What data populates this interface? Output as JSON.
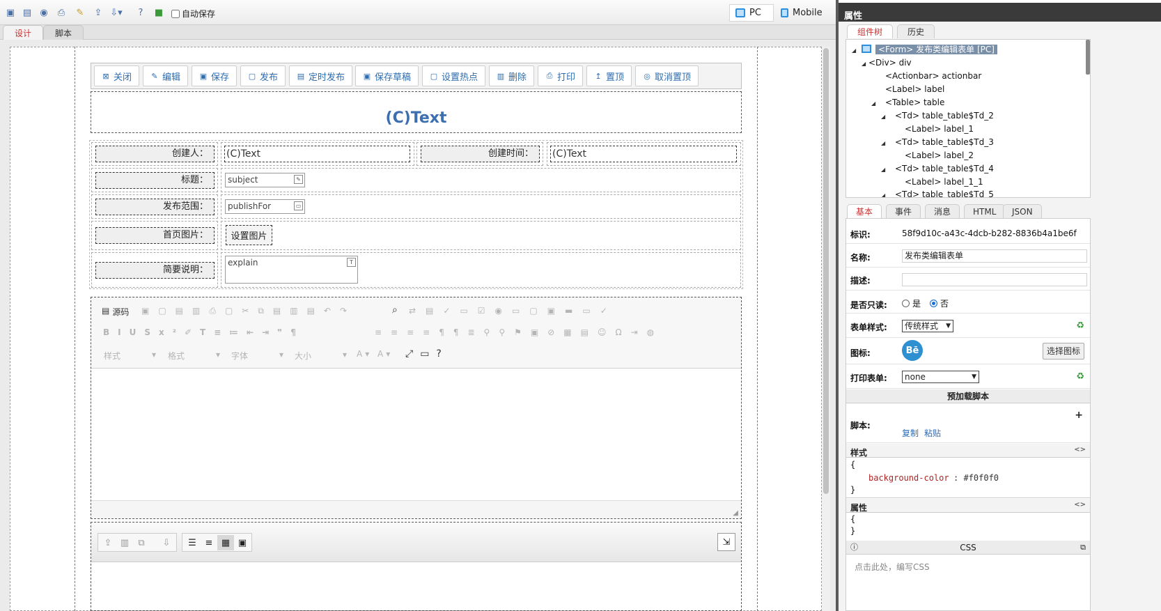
{
  "toolbar": {
    "autosave_label": "自动保存",
    "device_pc": "PC",
    "device_mobile": "Mobile"
  },
  "design_tabs": [
    "设计",
    "脚本"
  ],
  "actionbar": [
    "关闭",
    "编辑",
    "保存",
    "发布",
    "定时发布",
    "保存草稿",
    "设置热点",
    "删除",
    "打印",
    "置顶",
    "取消置顶"
  ],
  "form": {
    "title": "(C)Text",
    "rows": {
      "creator_label": "创建人：",
      "creator_value": "(C)Text",
      "created_label": "创建时间：",
      "created_value": "(C)Text",
      "subject_label": "标题：",
      "subject_value": "subject",
      "publishfor_label": "发布范围：",
      "publishfor_value": "publishFor",
      "image_label": "首页图片：",
      "image_button": "设置图片",
      "explain_label": "简要说明：",
      "explain_value": "explain"
    }
  },
  "editor": {
    "source_label": "源码",
    "style_combo": "样式",
    "format_combo": "格式",
    "font_combo": "字体",
    "size_combo": "大小"
  },
  "panel": {
    "title": "属性",
    "tree_tabs": [
      "组件树",
      "历史"
    ],
    "tree": [
      "<Form> 发布类编辑表单 [PC]",
      "<Div> div",
      "<Actionbar> actionbar",
      "<Label> label",
      "<Table> table",
      "<Td> table_table$Td_2",
      "<Label> label_1",
      "<Td> table_table$Td_3",
      "<Label> label_2",
      "<Td> table_table$Td_4",
      "<Label> label_1_1",
      "<Td> table_table$Td_5"
    ],
    "prop_tabs": [
      "基本",
      "事件",
      "消息",
      "HTML",
      "JSON"
    ],
    "props": {
      "id_label": "标识:",
      "id_value": "58f9d10c-a43c-4dcb-b282-8836b4a1be6f",
      "name_label": "名称:",
      "name_value": "发布类编辑表单",
      "desc_label": "描述:",
      "readonly_label": "是否只读:",
      "readonly_yes": "是",
      "readonly_no": "否",
      "formstyle_label": "表单样式:",
      "formstyle_value": "传统样式",
      "icon_label": "图标:",
      "icon_glyph": "Bē",
      "choose_icon": "选择图标",
      "print_label": "打印表单:",
      "print_value": "none",
      "preload_header": "预加载脚本",
      "script_label": "脚本:",
      "copy": "复制",
      "paste": "粘贴",
      "style_header": "样式",
      "style_open": "{",
      "style_prop": "background-color",
      "style_val": ": #f0f0f0",
      "style_close": "}",
      "attr_header": "属性",
      "attr_open": "{",
      "attr_close": "}",
      "css_header": "CSS",
      "css_placeholder": "点击此处，编写CSS"
    },
    "colors": {
      "accent": "#2e6db0",
      "tree_selected": "#7a8fa8",
      "danger_tab": "#d03030"
    }
  }
}
